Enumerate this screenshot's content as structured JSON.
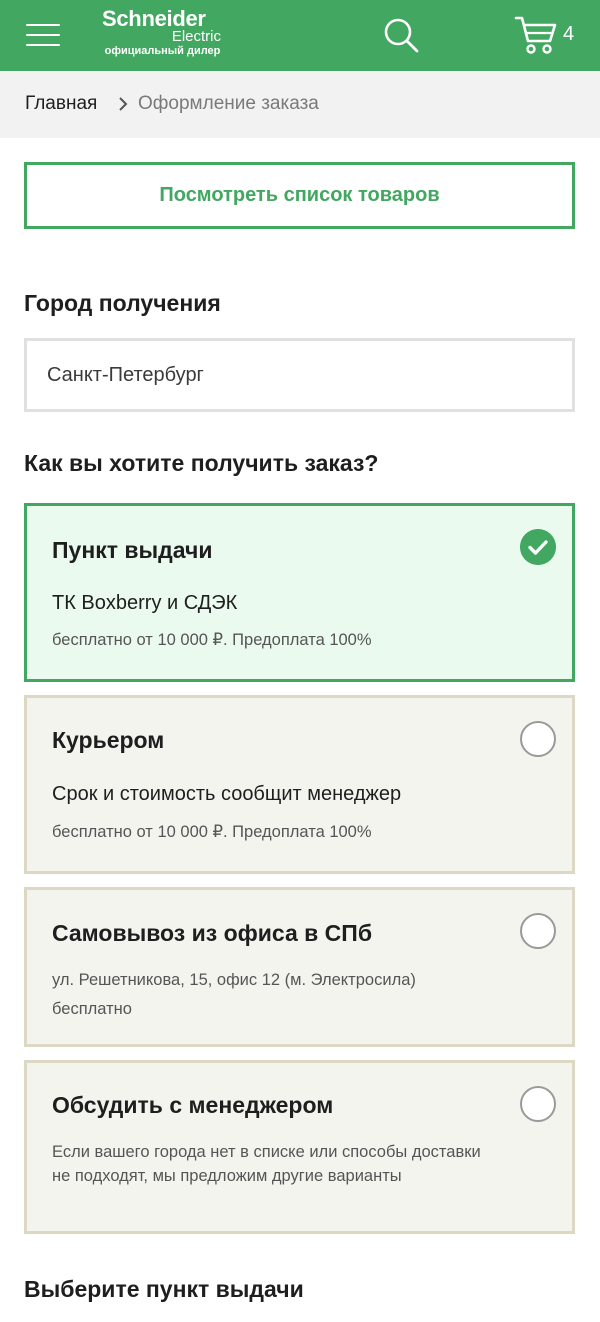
{
  "header": {
    "logo_main": "Schneider",
    "logo_sub": "Electric",
    "logo_dealer": "официальный дилер",
    "cart_count": "4",
    "icons": [
      "menu-icon",
      "search-icon",
      "cart-icon"
    ]
  },
  "breadcrumb": {
    "home": "Главная",
    "current": "Оформление заказа"
  },
  "view_products_label": "Посмотреть список товаров",
  "city": {
    "title": "Город получения",
    "value": "Санкт-Петербург"
  },
  "delivery": {
    "title": "Как вы хотите получить заказ?",
    "options": [
      {
        "title": "Пункт выдачи",
        "line": "ТК Boxberry и СДЭК",
        "note": "бесплатно от 10 000 ₽. Предоплата 100%",
        "selected": true
      },
      {
        "title": "Курьером",
        "line": "Срок и стоимость сообщит менеджер",
        "note": "бесплатно от 10 000 ₽. Предоплата 100%",
        "selected": false
      },
      {
        "title": "Самовывоз из офиса в СПб",
        "note": "ул. Решетникова, 15, офис 12 (м. Электросила)",
        "note2": "бесплатно",
        "selected": false
      },
      {
        "title": "Обсудить с менеджером",
        "note": "Если вашего города нет в списке или способы доставки не подходят, мы предложим другие варианты",
        "selected": false
      }
    ]
  },
  "pickup_title": "Выберите пункт выдачи",
  "colors": {
    "brand_green": "#42a760",
    "selected_bg": "#ebfaee",
    "option_bg": "#f4f4ef",
    "option_border": "#dcd8c3"
  }
}
